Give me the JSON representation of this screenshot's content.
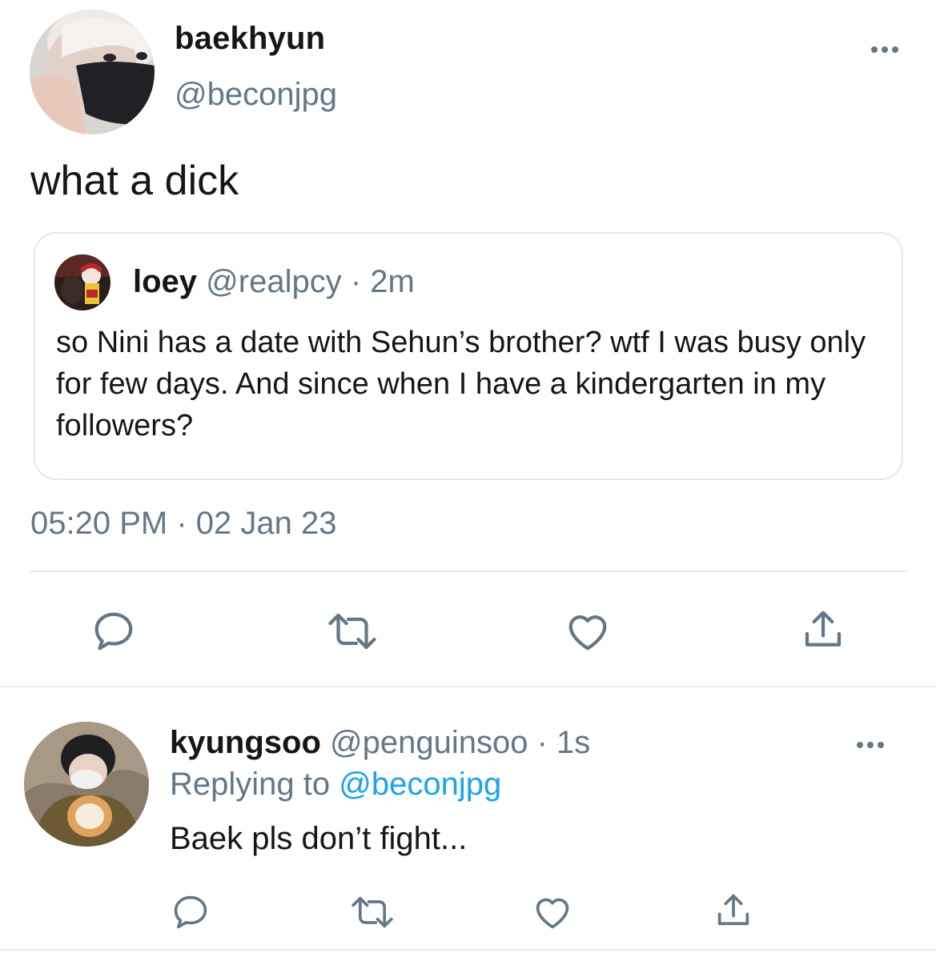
{
  "main_tweet": {
    "display_name": "baekhyun",
    "handle": "@beconjpg",
    "text": "what a dick",
    "timestamp": "05:20 PM · 02 Jan 23",
    "avatar": "avatar-photo-masked-person"
  },
  "quoted_tweet": {
    "display_name": "loey",
    "handle": "@realpcy",
    "time_meta": " · 2m",
    "text": "so Nini has a date with Sehun’s brother? wtf I was busy only for few days. And since when I have a kindergarten in my followers?",
    "avatar": "avatar-photo-clown"
  },
  "actions": {
    "icons": [
      "reply-icon",
      "retweet-icon",
      "like-icon",
      "share-icon"
    ]
  },
  "reply_tweet": {
    "display_name": "kyungsoo",
    "handle": "@penguinsoo",
    "time_meta": " · 1s",
    "replying_prefix": "Replying to ",
    "replying_mention": "@beconjpg",
    "text": "Baek pls don’t fight...",
    "avatar": "avatar-photo-person-with-dog"
  },
  "colors": {
    "text_primary": "#14171a",
    "text_secondary": "#657786",
    "accent": "#1da1f2",
    "border": "#e1e8ed",
    "divider": "#e6ecf0"
  }
}
